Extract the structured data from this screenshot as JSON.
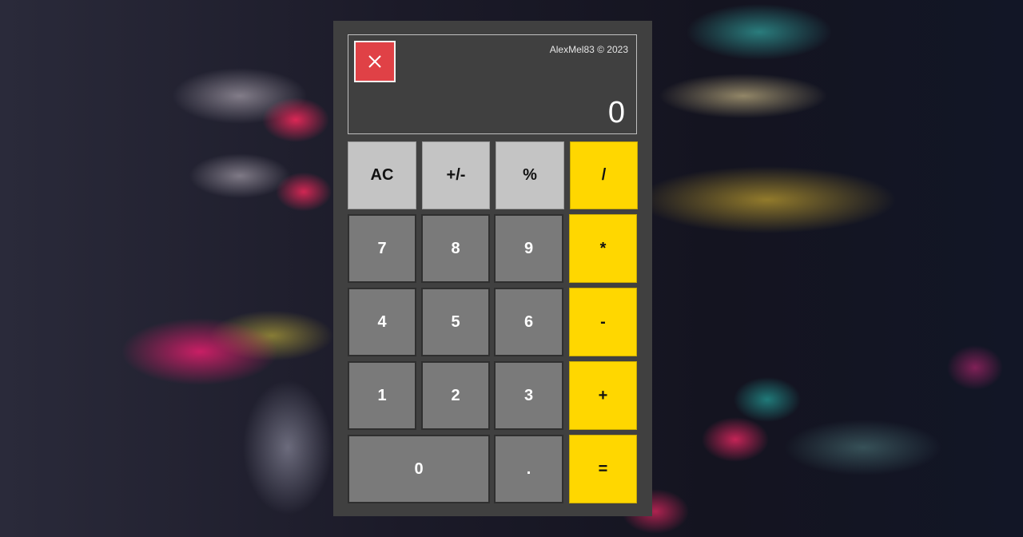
{
  "window": {
    "copyright": "AlexMel83 © 2023",
    "display_value": "0",
    "close_icon": "close-icon",
    "colors": {
      "panel": "#404040",
      "close": "#e04146",
      "function_key": "#c4c4c4",
      "digit_key": "#7a7a7a",
      "operator_key": "#ffd700"
    }
  },
  "keys": {
    "ac": "AC",
    "sign": "+/-",
    "percent": "%",
    "divide": "/",
    "seven": "7",
    "eight": "8",
    "nine": "9",
    "multiply": "*",
    "four": "4",
    "five": "5",
    "six": "6",
    "minus": "-",
    "one": "1",
    "two": "2",
    "three": "3",
    "plus": "+",
    "zero": "0",
    "decimal": ".",
    "equals": "="
  }
}
